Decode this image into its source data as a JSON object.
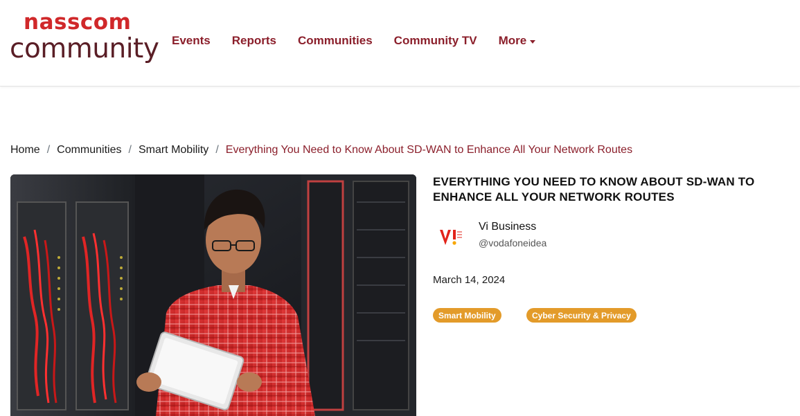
{
  "brand": {
    "line1": "nasscom",
    "line2": "community",
    "colors": {
      "red": "#d0282a",
      "maroon": "#5a1e26",
      "nav": "#8b1f2b"
    }
  },
  "nav": {
    "items": [
      {
        "label": "Events"
      },
      {
        "label": "Reports"
      },
      {
        "label": "Communities"
      },
      {
        "label": "Community TV"
      },
      {
        "label": "More",
        "dropdown": true
      }
    ]
  },
  "breadcrumb": {
    "items": [
      "Home",
      "Communities",
      "Smart Mobility"
    ],
    "current": "Everything You Need to Know About SD-WAN to Enhance All Your Network Routes",
    "separator": "/"
  },
  "article": {
    "title": "Everything You Need to Know About SD-WAN to Enhance All Your Network Routes",
    "author": {
      "name": "Vi Business",
      "handle": "@vodafoneidea",
      "logo_text": "Vi",
      "logo_colors": {
        "red": "#e2231a",
        "yellow": "#f7a600"
      }
    },
    "date": "March 14, 2024",
    "tags": [
      "Smart Mobility",
      "Cyber Security & Privacy"
    ],
    "tag_color": "#e39b2a"
  }
}
